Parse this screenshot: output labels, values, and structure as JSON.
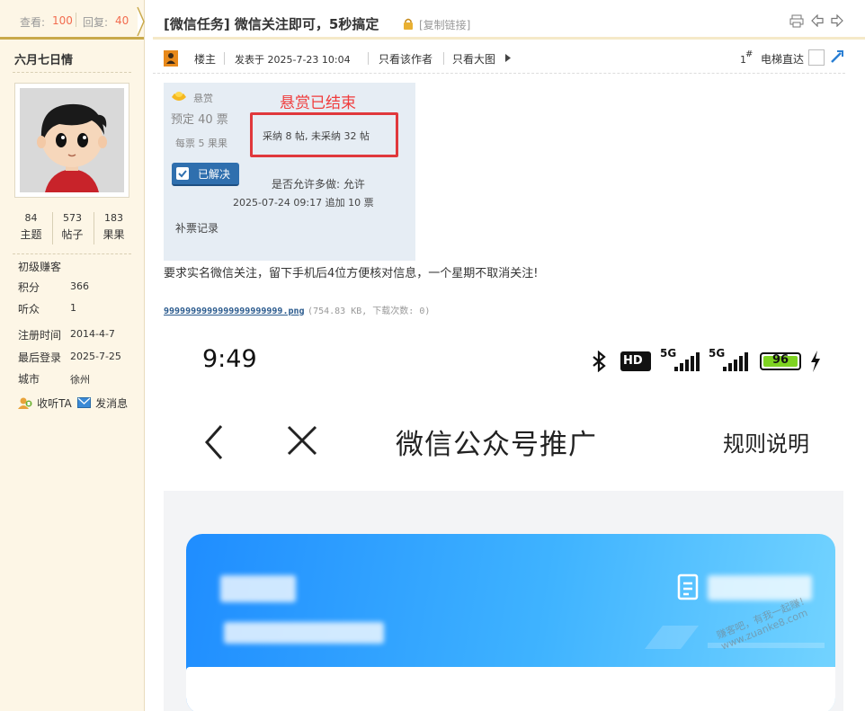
{
  "stats": {
    "views_label": "查看:",
    "views": "100",
    "replies_label": "回复:",
    "replies": "40"
  },
  "thread": {
    "title": "[微信任务] 微信关注即可，5秒搞定",
    "copy_link": "[复制链接]"
  },
  "user": {
    "name": "六月七日情",
    "counts": [
      {
        "value": "84",
        "label": "主题"
      },
      {
        "value": "573",
        "label": "帖子"
      },
      {
        "value": "183",
        "label": "果果"
      }
    ],
    "rank": "初级赚客",
    "info": [
      {
        "label": "积分",
        "value": "366"
      },
      {
        "label": "听众",
        "value": "1"
      },
      {
        "label": "注册时间",
        "value": "2014-4-7"
      },
      {
        "label": "最后登录",
        "value": "2025-7-25"
      },
      {
        "label": "城市",
        "value": "徐州"
      }
    ],
    "follow": "收听TA",
    "message": "发消息"
  },
  "meta": {
    "owner": "楼主",
    "posted": "发表于 2025-7-23 10:04",
    "only_author": "只看该作者",
    "only_big": "只看大图",
    "floor_num": "1",
    "floor_mark": "#",
    "elevator": "电梯直达"
  },
  "reward": {
    "label": "悬赏",
    "budget": "预定 40 票",
    "per": "每票 5 果果",
    "solved": "已解决",
    "ended": "悬赏已结束",
    "adopted": "采纳 8 帖, 未采纳 32 帖",
    "multi": "是否允许多做: 允许",
    "added": "2025-07-24 09:17 追加 10 票",
    "record": "补票记录"
  },
  "post": {
    "text": "要求实名微信关注，留下手机后4位方便核对信息，一个星期不取消关注!",
    "attachment_name": "9999999999999999999999.png",
    "attachment_info": "(754.83 KB, 下载次数: 0)"
  },
  "phone": {
    "time": "9:49",
    "hd": "HD",
    "sig1": "5G",
    "sig2": "5G",
    "battery": "96",
    "title": "微信公众号推广",
    "rules": "规则说明",
    "watermark": "赚客吧，有我一起赚！\nwww.zuanke8.com"
  },
  "colors": {
    "accent": "#f26c4f",
    "link": "#2b5b8e",
    "reward_red": "#f03c3c",
    "card_blue": "#1f8dff"
  }
}
